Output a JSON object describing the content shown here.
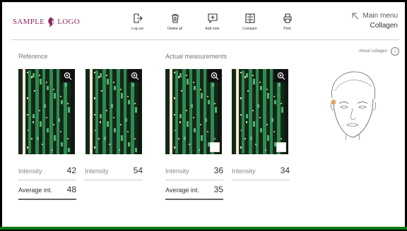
{
  "logo": {
    "left": "SAMPLE",
    "right": "LOGO"
  },
  "toolbar": [
    {
      "label": "Log out",
      "icon": "logout-icon"
    },
    {
      "label": "Delete all",
      "icon": "trash-icon"
    },
    {
      "label": "Add note",
      "icon": "note-icon"
    },
    {
      "label": "Compare",
      "icon": "compare-icon"
    },
    {
      "label": "Print",
      "icon": "printer-icon"
    }
  ],
  "main_menu": {
    "label": "Main menu",
    "section": "Collagen"
  },
  "about": {
    "label": "About collagen"
  },
  "reference": {
    "title": "Reference",
    "intensity_1": {
      "label": "Intensity",
      "value": "42"
    },
    "intensity_2": {
      "label": "Intensity",
      "value": "54"
    },
    "average": {
      "label": "Average int.",
      "value": "48"
    }
  },
  "actual": {
    "title": "Actual measurements",
    "intensity_1": {
      "label": "Intensity",
      "value": "36"
    },
    "intensity_2": {
      "label": "Intensity",
      "value": "34"
    },
    "average": {
      "label": "Average int.",
      "value": "35"
    }
  },
  "colors": {
    "brand": "#8b2a5e",
    "accent_green": "#0b7a12",
    "highlight": "#e8a04a"
  }
}
